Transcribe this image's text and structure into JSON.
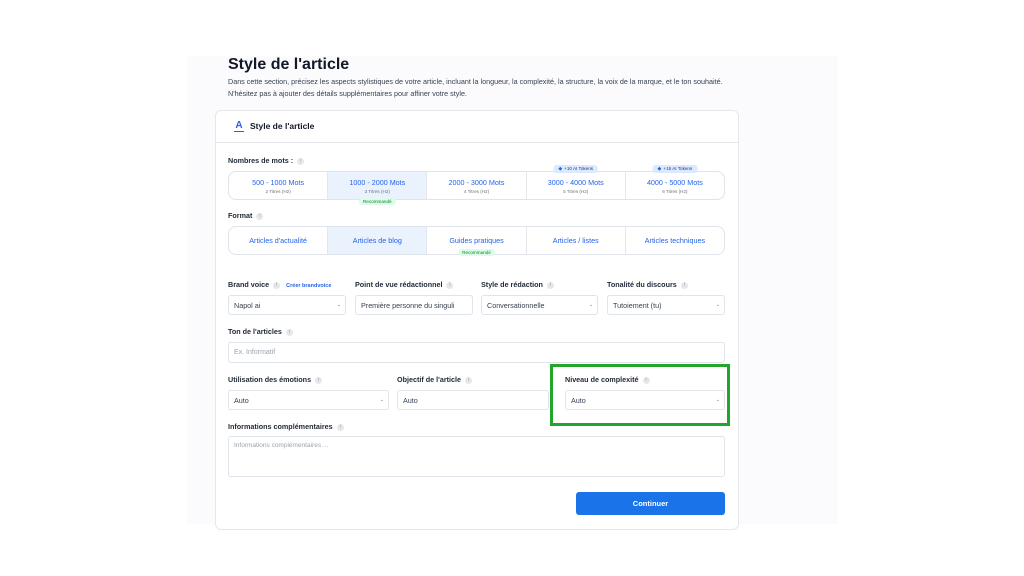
{
  "page": {
    "title": "Style de l'article",
    "description": "Dans cette section, précisez les aspects stylistiques de votre article, incluant la longueur, la complexité, la structure, la voix de la marque, et le ton souhaité. N'hésitez pas à ajouter des détails supplémentaires pour affiner votre style."
  },
  "card": {
    "title": "Style de l'article",
    "icon": "text-format-icon"
  },
  "word_count": {
    "label": "Nombres de mots :",
    "options": [
      {
        "label": "500 - 1000 Mots",
        "sub": "2 Titres (H2)"
      },
      {
        "label": "1000 - 2000 Mots",
        "sub": "3 Titres (H2)",
        "badge": "Recommandé",
        "selected": true
      },
      {
        "label": "2000 - 3000 Mots",
        "sub": "4 Titres (H2)"
      },
      {
        "label": "3000 - 4000 Mots",
        "sub": "5 Titres (H2)",
        "token_badge": "+10 AI Tokens"
      },
      {
        "label": "4000 - 5000 Mots",
        "sub": "6 Titres (H2)",
        "token_badge": "+15 AI Tokens"
      }
    ]
  },
  "format": {
    "label": "Format",
    "options": [
      {
        "label": "Articles d'actualité"
      },
      {
        "label": "Articles de blog",
        "selected": true
      },
      {
        "label": "Guides pratiques",
        "badge": "Recommandé"
      },
      {
        "label": "Articles / listes"
      },
      {
        "label": "Articles techniques"
      }
    ]
  },
  "brand_voice": {
    "label": "Brand voice",
    "link": "Créer brandvoice",
    "value": "Napol ai"
  },
  "point_of_view": {
    "label": "Point de vue rédactionnel",
    "value": "Première personne du singuli"
  },
  "writing_style": {
    "label": "Style de rédaction",
    "value": "Conversationnelle"
  },
  "tone_discourse": {
    "label": "Tonalité du discours",
    "value": "Tutoiement (tu)"
  },
  "article_tone": {
    "label": "Ton de l'articles",
    "placeholder": "Ex. Informatif"
  },
  "emotions": {
    "label": "Utilisation des émotions",
    "value": "Auto"
  },
  "objective": {
    "label": "Objectif de l'article",
    "value": "Auto"
  },
  "complexity": {
    "label": "Niveau de complexité",
    "value": "Auto"
  },
  "additional_info": {
    "label": "Informations complémentaires",
    "placeholder": "Informations complémentaires ..."
  },
  "continue_button": "Continuer",
  "colors": {
    "accent": "#1a73e8",
    "highlight": "#22a52b",
    "selected_bg": "#eaf2fd"
  }
}
